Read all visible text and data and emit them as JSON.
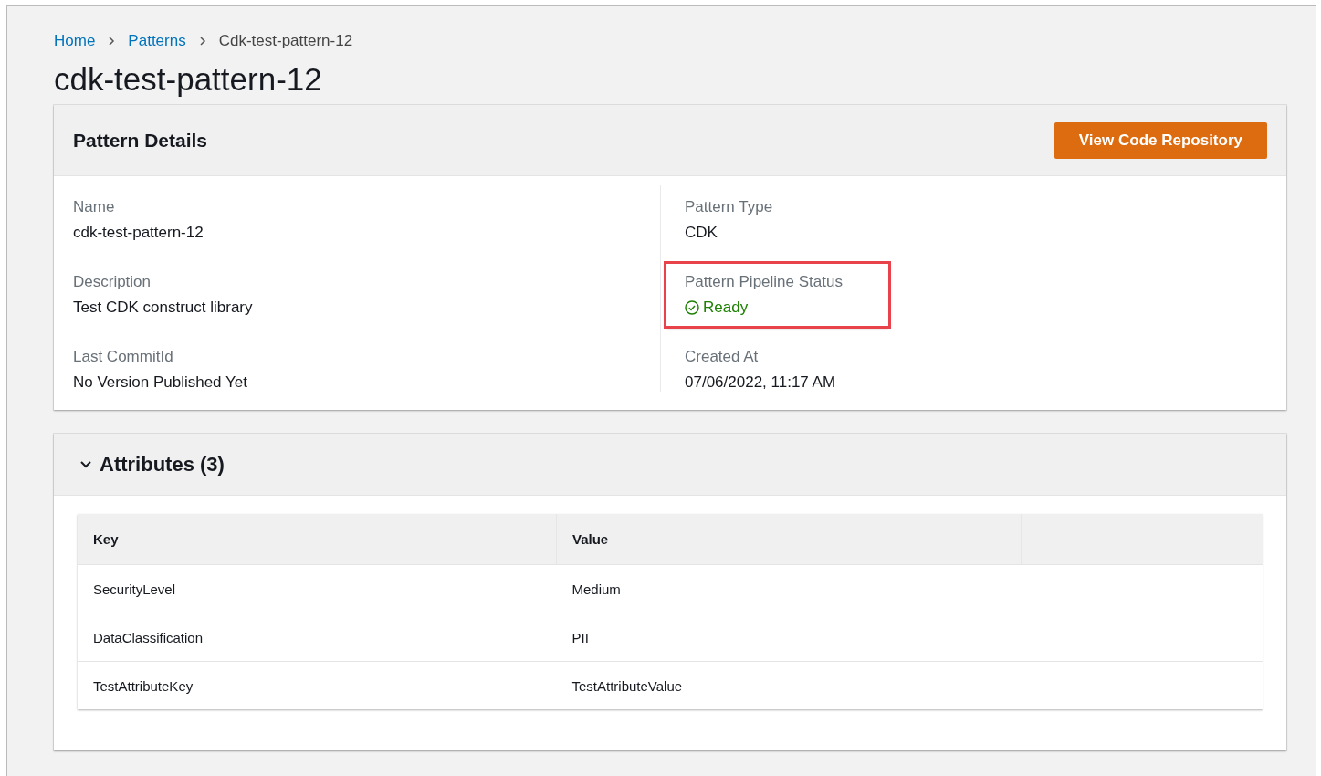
{
  "breadcrumbs": [
    {
      "label": "Home",
      "link": true
    },
    {
      "label": "Patterns",
      "link": true
    },
    {
      "label": "Cdk-test-pattern-12",
      "link": false
    }
  ],
  "page_title": "cdk-test-pattern-12",
  "details": {
    "title": "Pattern Details",
    "button": "View Code Repository",
    "columns": [
      [
        {
          "label": "Name",
          "value": "cdk-test-pattern-12",
          "kind": "text",
          "highlighted": false
        },
        {
          "label": "Description",
          "value": "Test CDK construct library",
          "kind": "text",
          "highlighted": false
        },
        {
          "label": "Last CommitId",
          "value": "No Version Published Yet",
          "kind": "text",
          "highlighted": false
        }
      ],
      [
        {
          "label": "Pattern Type",
          "value": "CDK",
          "kind": "text",
          "highlighted": false
        },
        {
          "label": "Pattern Pipeline Status",
          "value": "Ready",
          "kind": "status",
          "highlighted": true
        },
        {
          "label": "Created At",
          "value": "07/06/2022, 11:17 AM",
          "kind": "text",
          "highlighted": false
        }
      ]
    ]
  },
  "attributes": {
    "title": "Attributes (3)",
    "expanded": true,
    "columns": [
      "Key",
      "Value"
    ],
    "rows": [
      [
        "SecurityLevel",
        "Medium"
      ],
      [
        "DataClassification",
        "PII"
      ],
      [
        "TestAttributeKey",
        "TestAttributeValue"
      ]
    ]
  }
}
